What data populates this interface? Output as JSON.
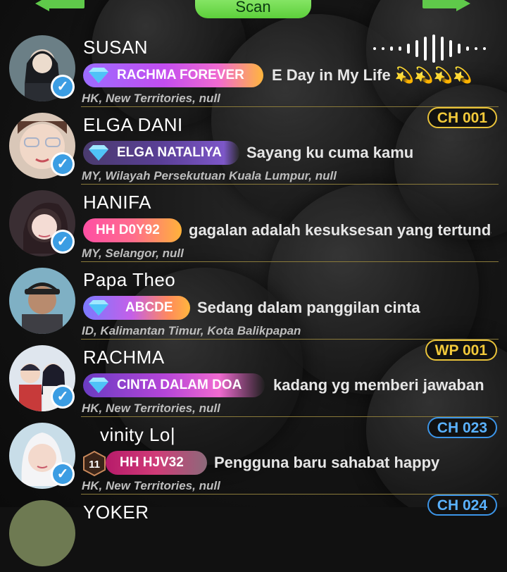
{
  "header": {
    "scan_label": "Scan"
  },
  "accent": {
    "green": "#5fc94a",
    "verified": "#3b9de3",
    "gold": "#e8c23a",
    "blue": "#3c95e8"
  },
  "users": [
    {
      "name": "SUSAN",
      "badge": "RACHMA FOREVER",
      "status": "E    Day in My Life 💫💫💫💫",
      "location": "HK, New Territories, null",
      "tag": "",
      "playing": true
    },
    {
      "name": "ELGA DANI",
      "badge": "ELGA NATALIYA",
      "status": "Sayang ku cuma kamu",
      "location": "MY, Wilayah Persekutuan Kuala Lumpur, null",
      "tag": "CH 001"
    },
    {
      "name": "HANIFA",
      "badge": "HH  D0Y92",
      "status": "gagalan adalah kesuksesan yang tertunda",
      "location": "MY, Selangor, null",
      "tag": ""
    },
    {
      "name": "Papa Theo",
      "badge": "ABCDE",
      "status": "Sedang dalam panggilan cinta",
      "location": "ID, Kalimantan Timur, Kota Balikpapan",
      "tag": ""
    },
    {
      "name": "RACHMA",
      "badge": "CINTA DALAM DOA",
      "status": "kadang yg memberi jawaban",
      "location": "HK, New Territories, null",
      "tag": "WP 001"
    },
    {
      "name": "vinity Lo|",
      "badge": "HH  HJV32",
      "status": "Pengguna baru sahabat happy",
      "location": "HK, New Territories, null",
      "tag": "CH 023",
      "level": "11"
    },
    {
      "name": "YOKER",
      "badge": "",
      "status": "",
      "location": "",
      "tag": "CH 024"
    }
  ]
}
